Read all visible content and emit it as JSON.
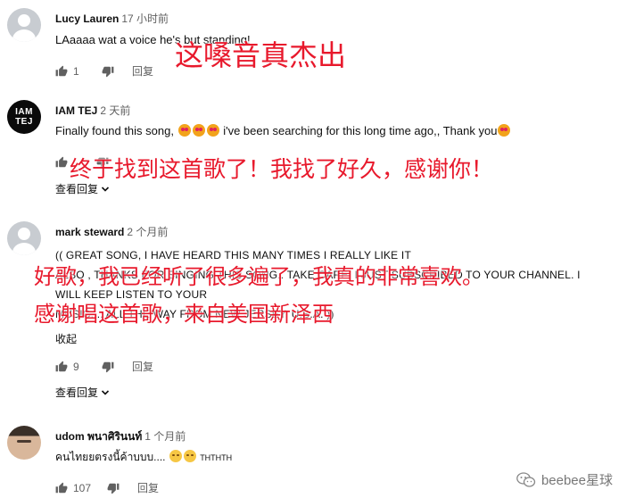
{
  "comments": [
    {
      "author": "Lucy Lauren",
      "time": "17 小时前",
      "text": "LAaaaa wat a voice he's but standing!",
      "likes": "1",
      "reply": "回复"
    },
    {
      "author": "IAM TEJ",
      "avatar_text_line1": "IAM",
      "avatar_text_line2": "TEJ",
      "time": "2 天前",
      "text_before": "Finally found this song,",
      "text_after": "i've been searching for this long time ago,, Thank you",
      "view_replies": "查看回复",
      "reply": "回复"
    },
    {
      "author": "mark steward",
      "time": "2 个月前",
      "lines": [
        "(( GREAT SONG, I HAVE HEARD THIS MANY TIMES I REALLY LIKE IT",
        "ALSO , THANKS FOR SINGING THIS SONG.. TAKE CARE. I JUST SUBSCRIBED TO YOUR CHANNEL. I",
        "WILL KEEP LISTEN TO YOUR",
        "MUSIC.... ALL THE WAY FROM NEW JERSEY, U.S.A. ))"
      ],
      "collapse": "收起",
      "likes": "9",
      "reply": "回复",
      "view_replies": "查看回复"
    },
    {
      "author": "udom พนาศิรินนท์",
      "time": "1 个月前",
      "text": "คนไทยยตรงนี้ค้าบบบ....",
      "text_tail": "THTHTH",
      "likes": "107",
      "reply": "回复"
    }
  ],
  "overlays": {
    "o1": "这嗓音真杰出",
    "o2": "终于找到这首歌了！我找了好久，感谢你！",
    "o3a": "好歌，我已经听了很多遍了，我真的非常喜欢。",
    "o3b": "感谢唱这首歌，来自美国新泽西"
  },
  "watermark": "beebee星球",
  "colors": {
    "overlay_red": "#e8192c",
    "meta_gray": "#606060"
  },
  "icons": [
    "thumb-up-icon",
    "thumb-down-icon",
    "chevron-down-icon",
    "wechat-icon"
  ]
}
